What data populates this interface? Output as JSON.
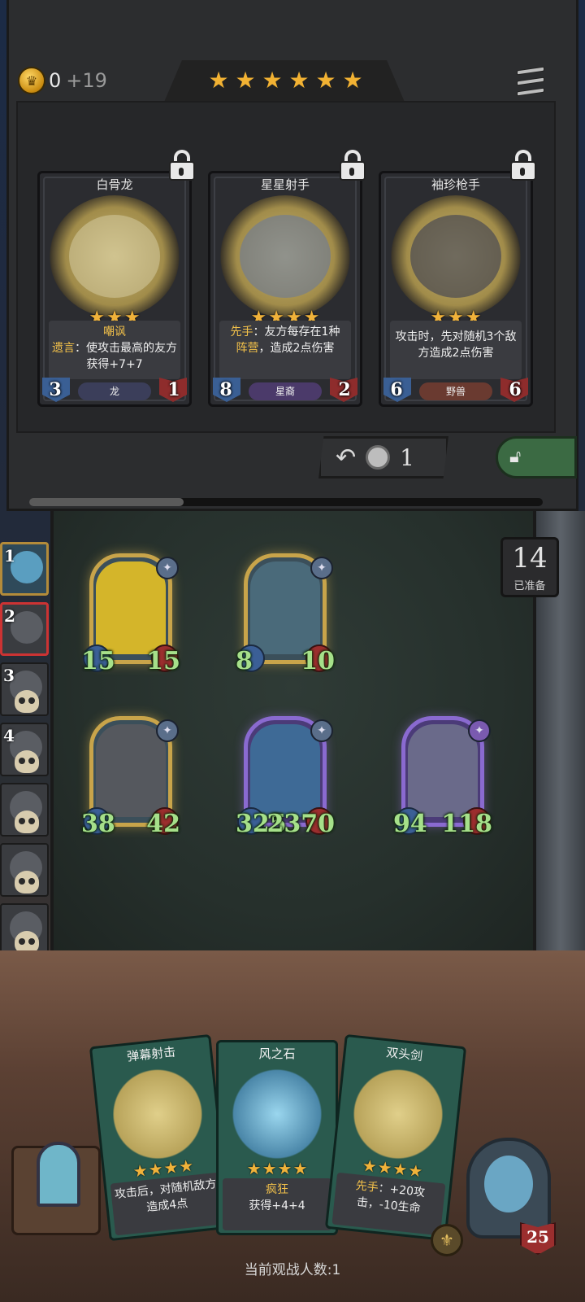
{
  "player": {
    "gold": "0",
    "income": "+19"
  },
  "shop": {
    "tier_stars": 6,
    "reroll_cost": "1",
    "cards": [
      {
        "name": "白骨龙",
        "stars": 3,
        "desc_kw": "嘲讽",
        "desc_kw2": "遗言",
        "desc": "：使攻击最高的友方获得+7+7",
        "attack": "3",
        "health": "1",
        "tribe": "龙",
        "tribe_color": "#3b3e5a",
        "art_color": "#d8cfa8"
      },
      {
        "name": "星星射手",
        "stars": 4,
        "desc_kw": "先手",
        "desc": "：友方每存在1种",
        "desc_kw2": "阵营",
        "desc2": "，造成2点伤害",
        "attack": "8",
        "health": "2",
        "tribe": "星裔",
        "tribe_color": "#4b3a6a",
        "art_color": "#6a7a9a"
      },
      {
        "name": "袖珍枪手",
        "stars": 3,
        "desc": "攻击时，先对随机3个敌方造成2点伤害",
        "attack": "6",
        "health": "6",
        "tribe": "野兽",
        "tribe_color": "#6a3a30",
        "art_color": "#4a4a52"
      }
    ]
  },
  "lobby": {
    "ready_count": "14",
    "ready_label": "已准备",
    "players": [
      {
        "rank": "1",
        "state": "active"
      },
      {
        "rank": "2",
        "state": "you"
      },
      {
        "rank": "3",
        "state": "dead"
      },
      {
        "rank": "4",
        "state": "dead"
      },
      {
        "rank": "",
        "state": "dead"
      },
      {
        "rank": "",
        "state": "dead"
      },
      {
        "rank": "",
        "state": "dead"
      },
      {
        "rank": "",
        "state": "dead"
      }
    ]
  },
  "board": {
    "units": [
      {
        "attack": "15",
        "health": "15",
        "frame": "gold",
        "art": "#d4b52a"
      },
      {
        "attack": "8",
        "health": "10",
        "frame": "gold",
        "art": "#4a6a7a"
      },
      {
        "attack": "38",
        "health": "42",
        "frame": "gold",
        "art": "#55585e"
      },
      {
        "attack": "325",
        "health": "2370",
        "frame": "purple",
        "art": "#3e6a96"
      },
      {
        "attack": "94",
        "health": "118",
        "frame": "purple",
        "art": "#6a6a8a"
      }
    ]
  },
  "hand": [
    {
      "name": "弹幕射击",
      "stars": 4,
      "desc": "攻击后，对随机敌方造成4点"
    },
    {
      "name": "风之石",
      "stars": 4,
      "desc_kw": "疯狂",
      "desc": "获得+4+4"
    },
    {
      "name": "双头剑",
      "stars": 4,
      "desc_kw": "先手",
      "desc": "：+20攻击，-10生命"
    }
  ],
  "hero": {
    "health": "25"
  },
  "viewers_label": "当前观战人数:1"
}
